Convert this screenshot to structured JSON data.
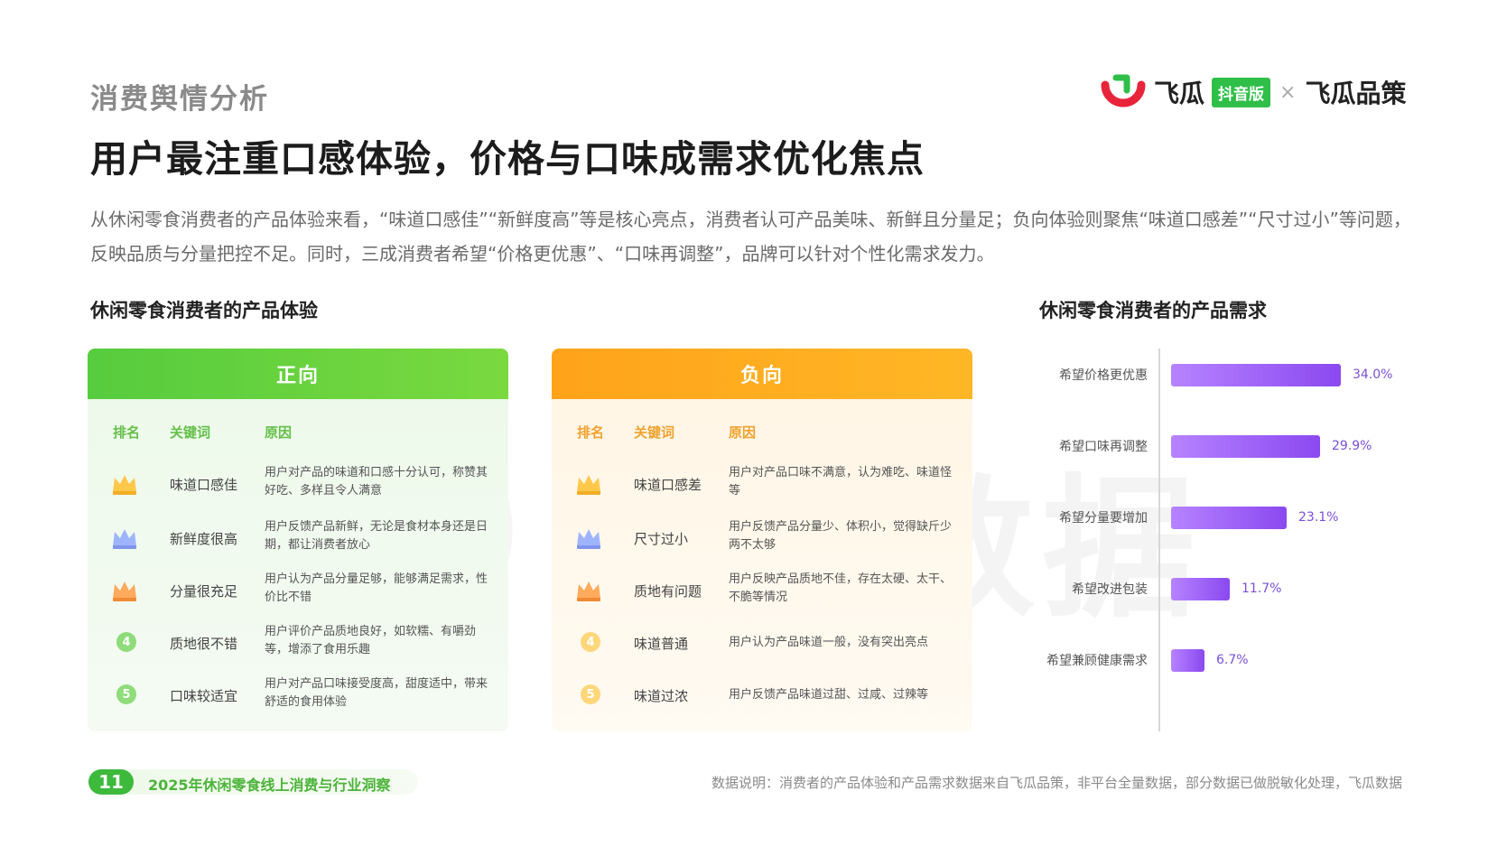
{
  "header": {
    "section_label": "消费舆情分析",
    "headline": "用户最注重口感体验，价格与口味成需求优化焦点",
    "intro": "从休闲零食消费者的产品体验来看，“味道口感佳”“新鲜度高”等是核心亮点，消费者认可产品美味、新鲜且分量足；负向体验则聚焦“味道口感差”“尺寸过小”等问题，反映品质与分量把控不足。同时，三成消费者希望“价格更优惠”、“口味再调整”，品牌可以针对个性化需求发力。"
  },
  "logo": {
    "brand1": "飞瓜",
    "badge": "抖音版",
    "separator": "×",
    "brand2": "飞瓜品策"
  },
  "watermark": "飞瓜数据",
  "experience": {
    "title": "休闲零食消费者的产品体验",
    "positive": {
      "header": "正向",
      "col_rank": "排名",
      "col_keyword": "关键词",
      "col_reason": "原因",
      "rows": [
        {
          "rank": "1",
          "icon": "gold-crown-icon",
          "keyword": "味道口感佳",
          "reason": "用户对产品的味道和口感十分认可，称赞其好吃、多样且令人满意"
        },
        {
          "rank": "2",
          "icon": "silver-crown-icon",
          "keyword": "新鲜度很高",
          "reason": "用户反馈产品新鲜，无论是食材本身还是日期，都让消费者放心"
        },
        {
          "rank": "3",
          "icon": "bronze-crown-icon",
          "keyword": "分量很充足",
          "reason": "用户认为产品分量足够，能够满足需求，性价比不错"
        },
        {
          "rank": "4",
          "icon": "",
          "keyword": "质地很不错",
          "reason": "用户评价产品质地良好，如软糯、有嚼劲等，增添了食用乐趣"
        },
        {
          "rank": "5",
          "icon": "",
          "keyword": "口味较适宜",
          "reason": "用户对产品口味接受度高，甜度适中，带来舒适的食用体验"
        }
      ]
    },
    "negative": {
      "header": "负向",
      "col_rank": "排名",
      "col_keyword": "关键词",
      "col_reason": "原因",
      "rows": [
        {
          "rank": "1",
          "icon": "gold-crown-icon",
          "keyword": "味道口感差",
          "reason": "用户对产品口味不满意，认为难吃、味道怪等"
        },
        {
          "rank": "2",
          "icon": "silver-crown-icon",
          "keyword": "尺寸过小",
          "reason": "用户反馈产品分量少、体积小，觉得缺斤少两不太够"
        },
        {
          "rank": "3",
          "icon": "bronze-crown-icon",
          "keyword": "质地有问题",
          "reason": "用户反映产品质地不佳，存在太硬、太干、不脆等情况"
        },
        {
          "rank": "4",
          "icon": "",
          "keyword": "味道普通",
          "reason": "用户认为产品味道一般，没有突出亮点"
        },
        {
          "rank": "5",
          "icon": "",
          "keyword": "味道过浓",
          "reason": "用户反馈产品味道过甜、过咸、过辣等"
        }
      ]
    }
  },
  "needs": {
    "title": "休闲零食消费者的产品需求"
  },
  "chart_data": {
    "type": "bar",
    "orientation": "horizontal",
    "categories": [
      "希望价格更优惠",
      "希望口味再调整",
      "希望分量要增加",
      "希望改进包装",
      "希望兼顾健康需求"
    ],
    "values": [
      34.0,
      29.9,
      23.1,
      11.7,
      6.7
    ],
    "value_labels": [
      "34.0%",
      "29.9%",
      "23.1%",
      "11.7%",
      "6.7%"
    ],
    "unit": "%",
    "xlim": [
      0,
      34.0
    ],
    "bar_color": "#9b5cf6"
  },
  "footer": {
    "page_number": "11",
    "report_title": "2025年休闲零食线上消费与行业洞察",
    "note": "数据说明：消费者的产品体验和产品需求数据来自飞瓜品策，非平台全量数据，部分数据已做脱敏化处理，飞瓜数据"
  },
  "colors": {
    "positive_accent": "#5ccf3f",
    "negative_accent": "#ffa91f",
    "bar_accent": "#9b5cf6"
  }
}
